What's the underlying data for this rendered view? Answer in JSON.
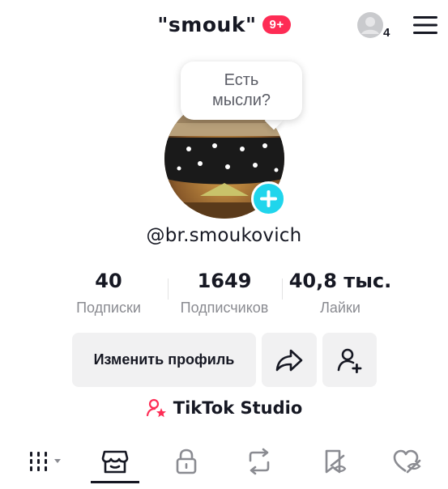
{
  "header": {
    "profile_name": "\"smouk\"",
    "notification_badge": "9+",
    "account_count": "4"
  },
  "bubble": {
    "text_line1": "Есть",
    "text_line2": "мысли?"
  },
  "profile": {
    "username": "@br.smoukovich"
  },
  "stats": [
    {
      "value": "40",
      "label": "Подписки"
    },
    {
      "value": "1649",
      "label": "Подписчиков"
    },
    {
      "value": "40,8 тыс.",
      "label": "Лайки"
    }
  ],
  "actions": {
    "edit_profile": "Изменить профиль"
  },
  "studio": {
    "label": "TikTok Studio"
  },
  "colors": {
    "accent_red": "#fe2c55",
    "accent_cyan": "#20d5ec",
    "text_primary": "#161823",
    "text_secondary": "#8a8b91",
    "button_bg": "#f1f1f2"
  },
  "tabs": [
    {
      "icon": "grid-icon",
      "active": true
    },
    {
      "icon": "shop-icon",
      "active": false
    },
    {
      "icon": "lock-icon",
      "active": false
    },
    {
      "icon": "repost-icon",
      "active": false
    },
    {
      "icon": "favorites-icon",
      "active": false
    },
    {
      "icon": "liked-icon",
      "active": false
    }
  ]
}
